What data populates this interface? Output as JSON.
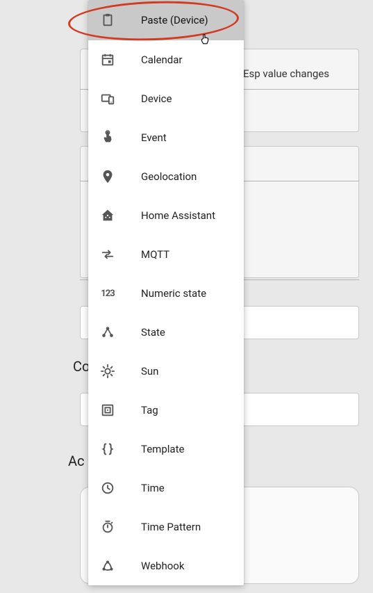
{
  "existing_trigger_text": "Esp value changes",
  "bg_labels": {
    "conditions_truncated": "Co",
    "actions_truncated": "Ac"
  },
  "menu": {
    "items": [
      {
        "id": "paste-device",
        "label": "Paste (Device)"
      },
      {
        "id": "calendar",
        "label": "Calendar"
      },
      {
        "id": "device",
        "label": "Device"
      },
      {
        "id": "event",
        "label": "Event"
      },
      {
        "id": "geolocation",
        "label": "Geolocation"
      },
      {
        "id": "home-assistant",
        "label": "Home Assistant"
      },
      {
        "id": "mqtt",
        "label": "MQTT"
      },
      {
        "id": "numeric-state",
        "label": "Numeric state"
      },
      {
        "id": "state",
        "label": "State"
      },
      {
        "id": "sun",
        "label": "Sun"
      },
      {
        "id": "tag",
        "label": "Tag"
      },
      {
        "id": "template",
        "label": "Template"
      },
      {
        "id": "time",
        "label": "Time"
      },
      {
        "id": "time-pattern",
        "label": "Time Pattern"
      },
      {
        "id": "webhook",
        "label": "Webhook"
      }
    ]
  },
  "annotation": {
    "highlighted_item": "paste-device",
    "highlight_shape": "red-ellipse",
    "cursor_type": "hand-pointer"
  }
}
